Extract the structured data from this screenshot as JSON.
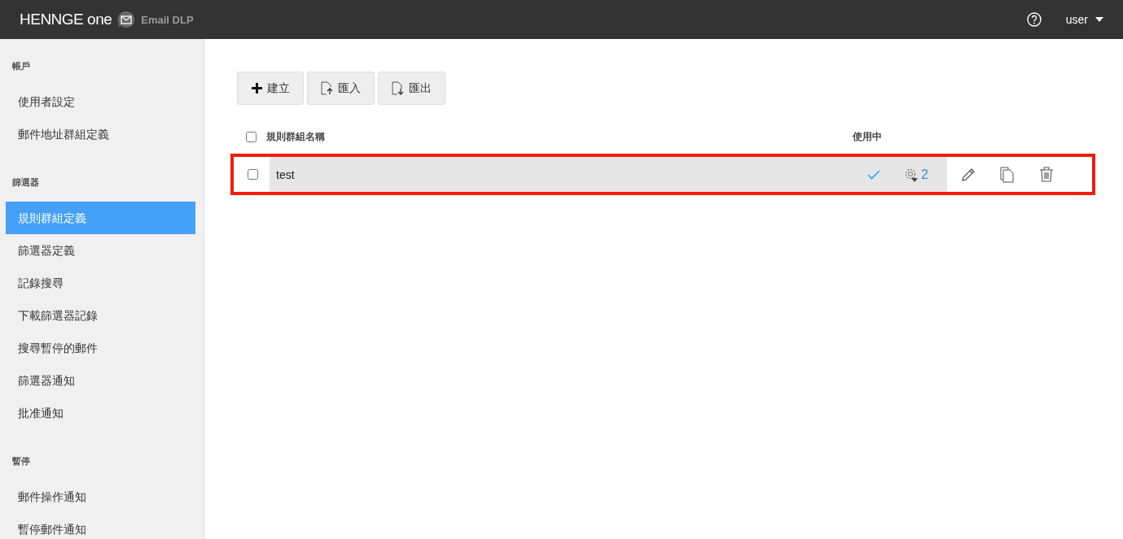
{
  "header": {
    "brand": "HENNGE one",
    "product": "Email DLP",
    "user": "user"
  },
  "sidebar": {
    "sections": [
      {
        "title": "帳戶",
        "items": [
          {
            "label": "使用者設定",
            "selected": false
          },
          {
            "label": "郵件地址群組定義",
            "selected": false
          }
        ]
      },
      {
        "title": "篩選器",
        "items": [
          {
            "label": "規則群組定義",
            "selected": true
          },
          {
            "label": "篩選器定義",
            "selected": false
          },
          {
            "label": "記錄搜尋",
            "selected": false
          },
          {
            "label": "下載篩選器記錄",
            "selected": false
          },
          {
            "label": "搜尋暫停的郵件",
            "selected": false
          },
          {
            "label": "篩選器通知",
            "selected": false
          },
          {
            "label": "批准通知",
            "selected": false
          }
        ]
      },
      {
        "title": "暫停",
        "items": [
          {
            "label": "郵件操作通知",
            "selected": false
          },
          {
            "label": "暫停郵件通知",
            "selected": false
          }
        ]
      }
    ]
  },
  "toolbar": [
    {
      "kind": "create",
      "label": "建立"
    },
    {
      "kind": "import",
      "label": "匯入"
    },
    {
      "kind": "export",
      "label": "匯出"
    }
  ],
  "table": {
    "columns": [
      "規則群組名稱",
      "使用中"
    ],
    "select_all": false,
    "rows": [
      {
        "checked": false,
        "name": "test",
        "in_use": true,
        "filter_count": "2",
        "highlighted": true
      }
    ]
  }
}
